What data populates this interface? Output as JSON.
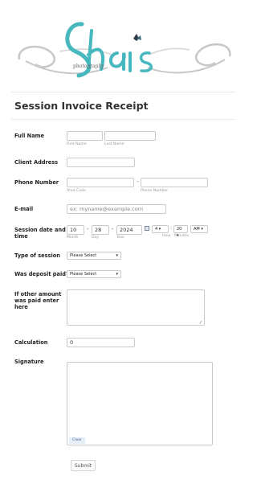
{
  "logo": {
    "text": "Shai's",
    "subtext": "photography"
  },
  "form": {
    "title": "Session Invoice Receipt",
    "full_name": {
      "label": "Full Name",
      "first_sub": "First Name",
      "last_sub": "Last Name",
      "first_value": "",
      "last_value": ""
    },
    "client_address": {
      "label": "Client Address",
      "value": ""
    },
    "phone": {
      "label": "Phone Number",
      "area_sub": "Area Code",
      "number_sub": "Phone Number",
      "separator": "-"
    },
    "email": {
      "label": "E-mail",
      "placeholder": "ex: myname@example.com"
    },
    "session": {
      "label_line1": "Session date and",
      "label_line2": "time",
      "month": "10",
      "day": "28",
      "year": "2024",
      "month_sub": "Month",
      "day_sub": "Day",
      "year_sub": "Year",
      "hour": "4",
      "minutes": "20",
      "ampm": "AM",
      "hour_sub": "Hour",
      "minutes_sub": "Minutes",
      "date_sep": "-",
      "time_sep": ":"
    },
    "type_of_session": {
      "label": "Type of session",
      "selected": "Please Select"
    },
    "deposit": {
      "label": "Was deposit paid?",
      "selected": "Please Select"
    },
    "other_amount": {
      "label_line1": "If other amount",
      "label_line2": "was paid enter",
      "label_line3": "here",
      "value": ""
    },
    "calculation": {
      "label": "Calculation",
      "value": "0"
    },
    "signature": {
      "label": "Signature",
      "clear_label": "Clear"
    },
    "submit_label": "Submit"
  },
  "colors": {
    "accent": "#46b8be",
    "logo_gray": "#c8c8c8"
  }
}
